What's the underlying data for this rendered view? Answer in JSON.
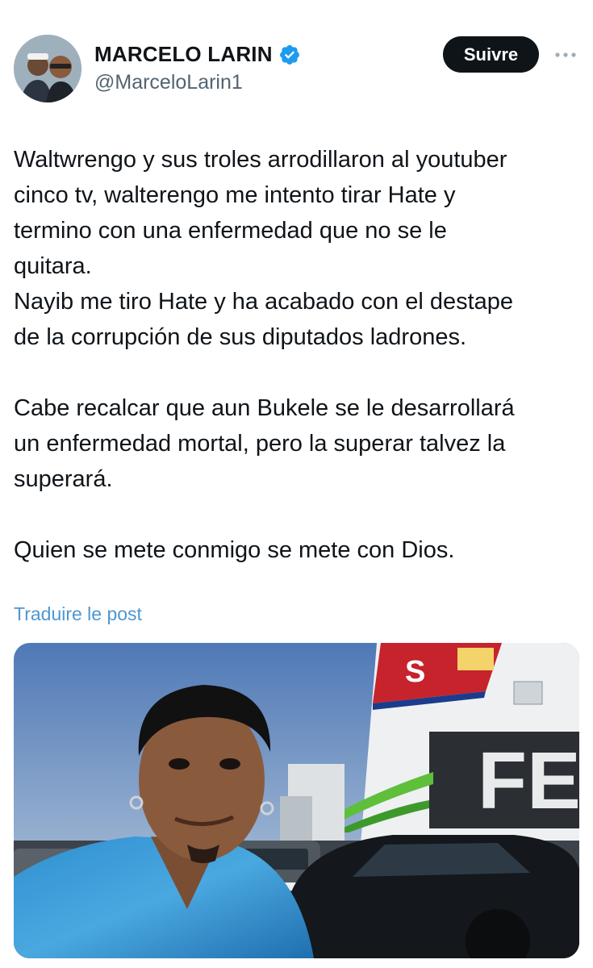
{
  "author": {
    "display_name": "MARCELO LARIN",
    "handle": "@MarceloLarin1",
    "verified": true
  },
  "actions": {
    "follow_label": "Suivre"
  },
  "tweet": {
    "text": "Waltwrengo y sus troles arrodillaron al youtuber\ncinco tv, walterengo me intento tirar Hate y\ntermino con una enfermedad que no se le\nquitara.\nNayib me tiro Hate y ha acabado con el destape\nde la corrupción de sus diputados ladrones.\n\nCabe recalcar que aun Bukele se le desarrollará\nun enfermedad mortal, pero la superar talvez la\nsuperará.\n\nQuien se mete conmigo se mete con Dios.",
    "translate_label": "Traduire le post"
  },
  "media": {
    "ship_hull_text": "S",
    "ship_sign_text": "FE"
  },
  "colors": {
    "verified": "#1d9bf0",
    "translate_link": "#4e97d1",
    "follow_bg": "#0f1419"
  }
}
